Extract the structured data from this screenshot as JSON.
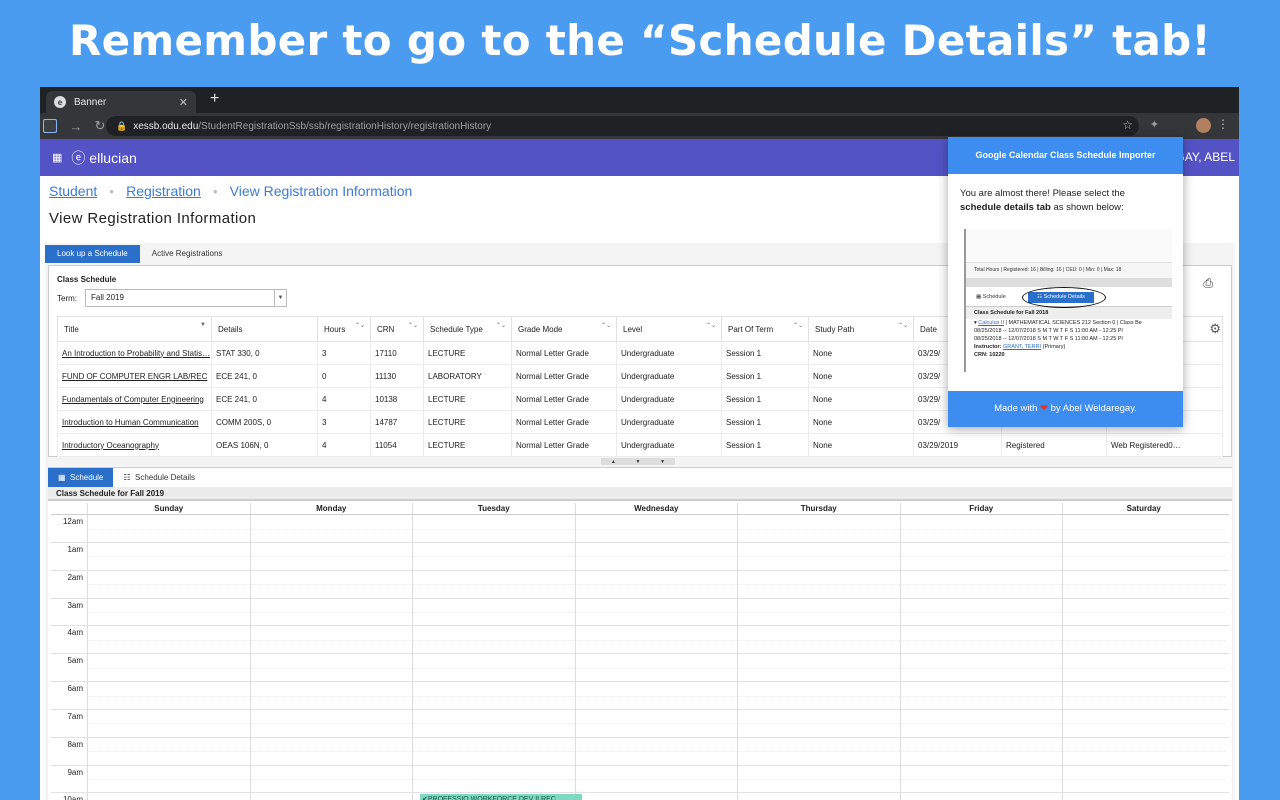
{
  "banner": {
    "text": "Remember to go to the “Schedule Details” tab!"
  },
  "browser": {
    "tab_title": "Banner",
    "url_host": "xessb.odu.edu",
    "url_path": "/StudentRegistrationSsb/ssb/registrationHistory/registrationHistory"
  },
  "app": {
    "logo": "ellucian",
    "user": "GAY, ABEL"
  },
  "breadcrumb": {
    "student": "Student",
    "registration": "Registration",
    "current": "View Registration Information"
  },
  "page_title": "View Registration Information",
  "reg_tabs": [
    "Look up a Schedule",
    "Active Registrations"
  ],
  "class_schedule": {
    "label": "Class Schedule",
    "term_label": "Term:",
    "term_value": "Fall 2019",
    "columns": [
      "Title",
      "Details",
      "Hours",
      "CRN",
      "Schedule Type",
      "Grade Mode",
      "Level",
      "Part Of Term",
      "Study Path",
      "Date",
      "",
      ""
    ],
    "rows": [
      {
        "title": "An Introduction to Probability and Statis…",
        "details": "STAT 330, 0",
        "hours": "3",
        "crn": "17110",
        "type": "LECTURE",
        "grade": "Normal Letter Grade",
        "level": "Undergraduate",
        "part": "Session 1",
        "path": "None",
        "date": "03/29/",
        "status": "",
        "method": ""
      },
      {
        "title": "FUND OF COMPUTER ENGR LAB/REC",
        "details": "ECE 241, 0",
        "hours": "0",
        "crn": "11130",
        "type": "LABORATORY",
        "grade": "Normal Letter Grade",
        "level": "Undergraduate",
        "part": "Session 1",
        "path": "None",
        "date": "03/29/",
        "status": "",
        "method": ""
      },
      {
        "title": "Fundamentals of Computer Engineering",
        "details": "ECE 241, 0",
        "hours": "4",
        "crn": "10138",
        "type": "LECTURE",
        "grade": "Normal Letter Grade",
        "level": "Undergraduate",
        "part": "Session 1",
        "path": "None",
        "date": "03/29/",
        "status": "",
        "method": ""
      },
      {
        "title": "Introduction to Human Communication",
        "details": "COMM 200S, 0",
        "hours": "3",
        "crn": "14787",
        "type": "LECTURE",
        "grade": "Normal Letter Grade",
        "level": "Undergraduate",
        "part": "Session 1",
        "path": "None",
        "date": "03/29/",
        "status": "",
        "method": ""
      },
      {
        "title": "Introductory Oceanography",
        "details": "OEAS 106N, 0",
        "hours": "4",
        "crn": "11054",
        "type": "LECTURE",
        "grade": "Normal Letter Grade",
        "level": "Undergraduate",
        "part": "Session 1",
        "path": "None",
        "date": "03/29/2019",
        "status": "Registered",
        "method": "Web Registered0…"
      }
    ]
  },
  "sched_tabs": [
    "Schedule",
    "Schedule Details"
  ],
  "schedule": {
    "heading": "Class Schedule for Fall 2019",
    "days": [
      "Sunday",
      "Monday",
      "Tuesday",
      "Wednesday",
      "Thursday",
      "Friday",
      "Saturday"
    ],
    "hours": [
      "12am",
      "1am",
      "2am",
      "3am",
      "4am",
      "5am",
      "6am",
      "7am",
      "8am",
      "9am",
      "10am"
    ],
    "event": "PROFESSIO WORKFORCE DEV II REC"
  },
  "popup": {
    "title": "Google Calendar Class Schedule Importer",
    "text1": "You are almost there! Please select the",
    "text_bold": "schedule details tab",
    "text2": " as shown below:",
    "img_totals": "Total Hours | Registered: 16 | Billing: 16 | CEU: 0 | Min: 0 | Max: 18",
    "img_tab_schedule": "Schedule",
    "img_tab_details": "Schedule Details",
    "img_heading": "Class Schedule for Fall 2018",
    "img_course_link": "Calculus II",
    "img_course_rest": " | MATHEMATICAL SCIENCES 212 Section 0 | Class Be",
    "img_line1": "08/25/2018 -- 12/07/2018   S M T W T F S   11:00 AM - 12:25 Pl",
    "img_line2": "08/25/2018 -- 12/07/2018   S M T W T F S   11:00 AM - 12:25 Pl",
    "img_instructor_label": "Instructor: ",
    "img_instructor": "GRANT, TERRI",
    "img_instructor_role": " (Primary)",
    "img_crn": "CRN: 10220",
    "footer_pre": "Made with ",
    "footer_post": " by Abel Weldaregay."
  }
}
